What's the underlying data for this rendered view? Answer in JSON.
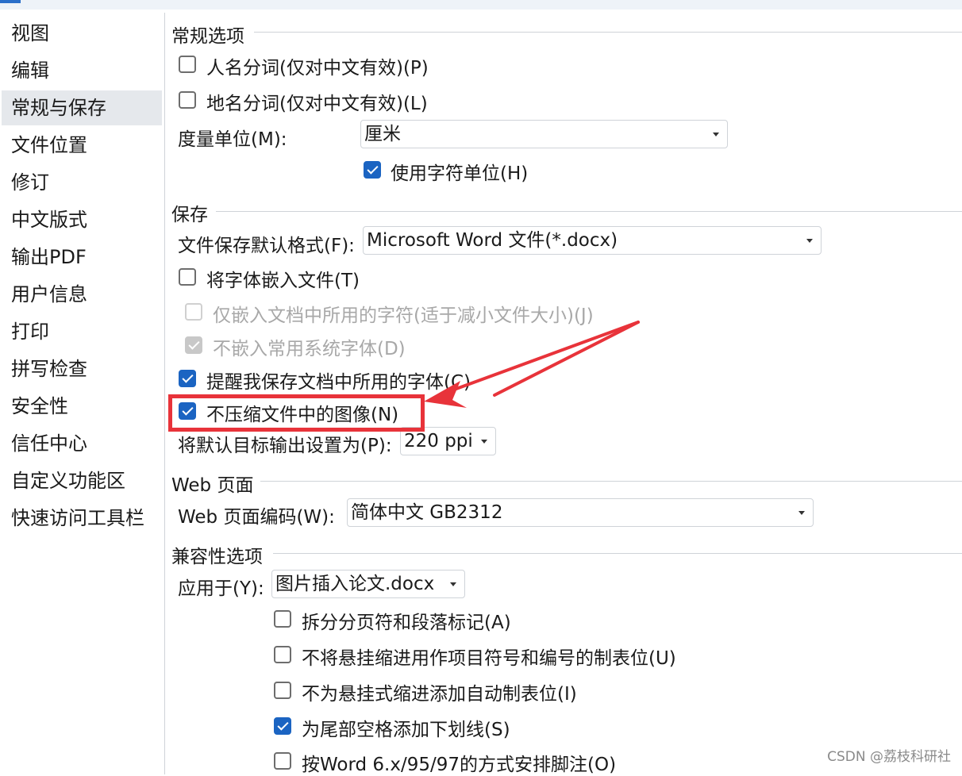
{
  "sidebar": {
    "items": [
      {
        "label": "视图"
      },
      {
        "label": "编辑"
      },
      {
        "label": "常规与保存",
        "selected": true
      },
      {
        "label": "文件位置"
      },
      {
        "label": "修订"
      },
      {
        "label": "中文版式"
      },
      {
        "label": "输出PDF"
      },
      {
        "label": "用户信息"
      },
      {
        "label": "打印"
      },
      {
        "label": "拼写检查"
      },
      {
        "label": "安全性"
      },
      {
        "label": "信任中心"
      },
      {
        "label": "自定义功能区"
      },
      {
        "label": "快速访问工具栏"
      }
    ]
  },
  "general": {
    "title": "常规选项",
    "name_seg": {
      "label": "人名分词(仅对中文有效)(P)",
      "checked": false
    },
    "place_seg": {
      "label": "地名分词(仅对中文有效)(L)",
      "checked": false
    },
    "unit_label": "度量单位(M):",
    "unit_value": "厘米",
    "char_unit": {
      "label": "使用字符单位(H)",
      "checked": true
    }
  },
  "save": {
    "title": "保存",
    "format_label": "文件保存默认格式(F):",
    "format_value": "Microsoft Word 文件(*.docx)",
    "embed_fonts": {
      "label": "将字体嵌入文件(T)",
      "checked": false
    },
    "embed_used": {
      "label": "仅嵌入文档中所用的字符(适于减小文件大小)(J)",
      "checked": false,
      "disabled": true
    },
    "no_common": {
      "label": "不嵌入常用系统字体(D)",
      "checked": true,
      "disabled": true
    },
    "remind_fonts": {
      "label": "提醒我保存文档中所用的字体(C)",
      "checked": true
    },
    "no_compress": {
      "label": "不压缩文件中的图像(N)",
      "checked": true
    },
    "default_output_label": "将默认目标输出设置为(P):",
    "default_output_value": "220 ppi"
  },
  "web": {
    "title": "Web 页面",
    "encoding_label": "Web 页面编码(W):",
    "encoding_value": "简体中文 GB2312"
  },
  "compat": {
    "title": "兼容性选项",
    "apply_label": "应用于(Y):",
    "apply_value": "图片插入论文.docx",
    "opts": [
      {
        "label": "拆分分页符和段落标记(A)",
        "checked": false
      },
      {
        "label": "不将悬挂缩进用作项目符号和编号的制表位(U)",
        "checked": false
      },
      {
        "label": "不为悬挂式缩进添加自动制表位(I)",
        "checked": false
      },
      {
        "label": "为尾部空格添加下划线(S)",
        "checked": true
      },
      {
        "label": "按Word 6.x/95/97的方式安排脚注(O)",
        "checked": false
      }
    ]
  },
  "watermark": "CSDN @荔枝科研社",
  "colors": {
    "accent": "#1b64c2",
    "highlight": "#e8333a"
  }
}
